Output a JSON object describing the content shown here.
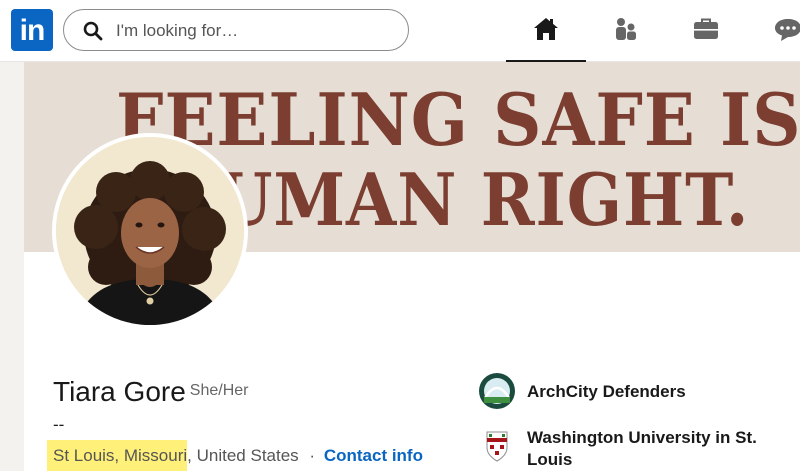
{
  "nav": {
    "logo_text": "in",
    "search_placeholder": "I'm looking for…",
    "items": [
      {
        "name": "home",
        "icon": "home-icon",
        "active": true
      },
      {
        "name": "network",
        "icon": "people-icon",
        "active": false
      },
      {
        "name": "jobs",
        "icon": "briefcase-icon",
        "active": false
      },
      {
        "name": "messaging",
        "icon": "chat-icon",
        "active": false
      }
    ]
  },
  "banner": {
    "line1": "FEELING SAFE IS",
    "line2": "UMAN RIGHT."
  },
  "profile": {
    "name": "Tiara Gore",
    "pronouns": "She/Her",
    "headline": "--",
    "location_highlighted": "St Louis, Missouri",
    "location_rest": ", United States",
    "separator": "·",
    "contact_link": "Contact info"
  },
  "organizations": [
    {
      "name": "ArchCity Defenders",
      "icon": "archcity-logo-icon"
    },
    {
      "name_line1": "Washington University in St.",
      "name_line2": "Louis",
      "icon": "washu-shield-icon"
    }
  ],
  "colors": {
    "brand": "#0a66c2",
    "banner_bg": "#e6ded5",
    "banner_text": "#7b3e30",
    "highlight": "#fff07a"
  }
}
